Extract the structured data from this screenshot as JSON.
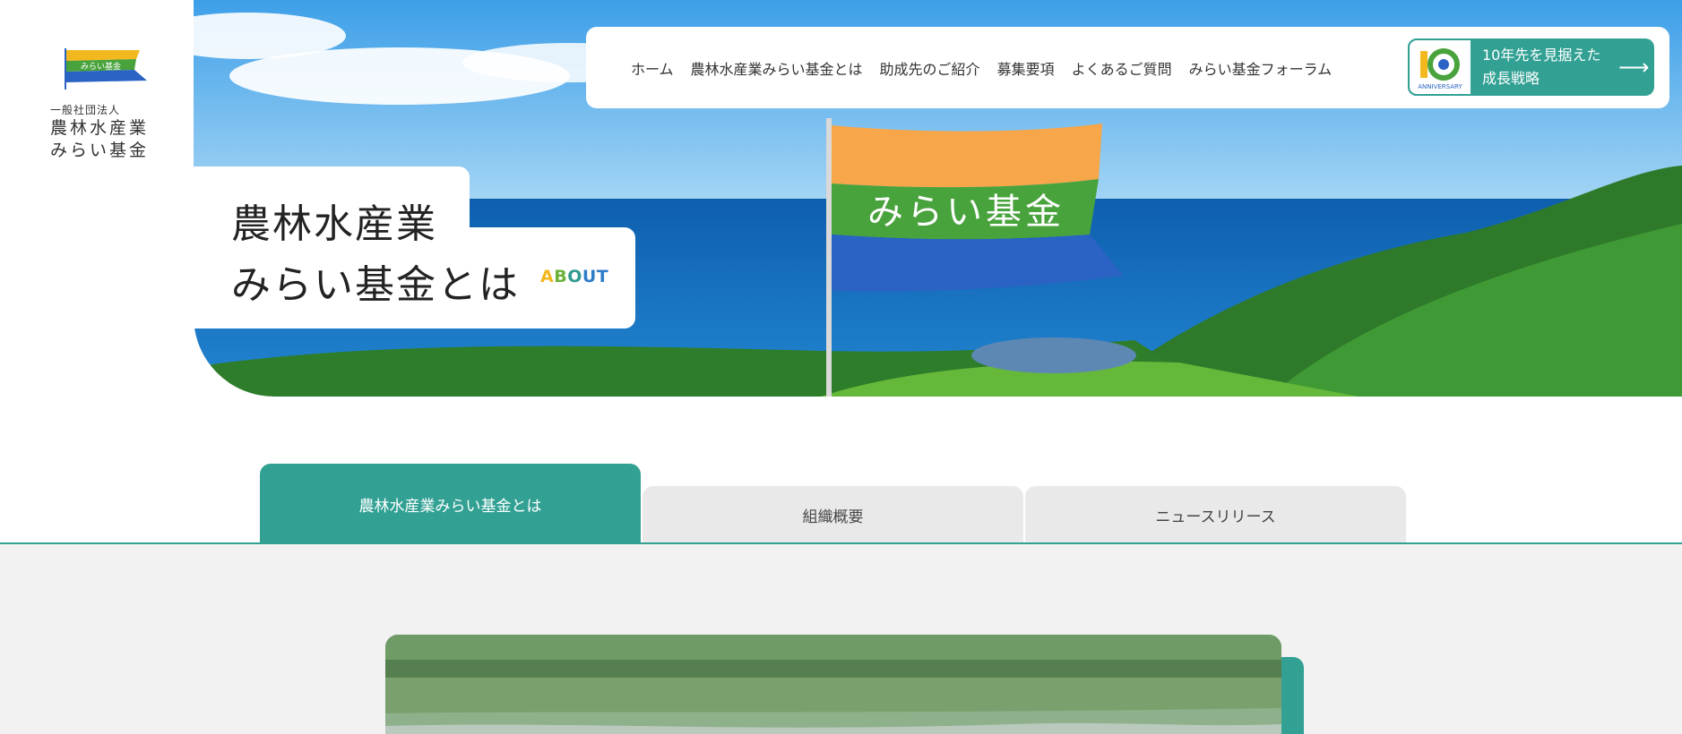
{
  "logo": {
    "flag_text": "みらい基金",
    "subtitle": "一般社団法人",
    "name_line1": "農林水産業",
    "name_line2": "みらい基金"
  },
  "nav": {
    "items": [
      {
        "label": "ホーム"
      },
      {
        "label": "農林水産業みらい基金とは"
      },
      {
        "label": "助成先のご紹介"
      },
      {
        "label": "募集要項"
      },
      {
        "label": "よくあるご質問"
      },
      {
        "label": "みらい基金フォーラム"
      }
    ],
    "anniversary": {
      "badge_label": "ANNIVERSARY",
      "line1": "10年先を見据えた",
      "line2": "成長戦略",
      "arrow_icon": "arrow-right-icon"
    }
  },
  "hero": {
    "title_line1": "農林水産業",
    "title_line2": "みらい基金とは",
    "about": [
      "A",
      "B",
      "O",
      "UT"
    ],
    "flag_text": "みらい基金"
  },
  "tabs": [
    {
      "label": "農林水産業みらい基金とは",
      "active": true
    },
    {
      "label": "組織概要",
      "active": false
    },
    {
      "label": "ニュースリリース",
      "active": false
    }
  ],
  "colors": {
    "accent": "#32a194",
    "tab_inactive": "#e9e9e9",
    "section_bg": "#f2f2f2"
  }
}
